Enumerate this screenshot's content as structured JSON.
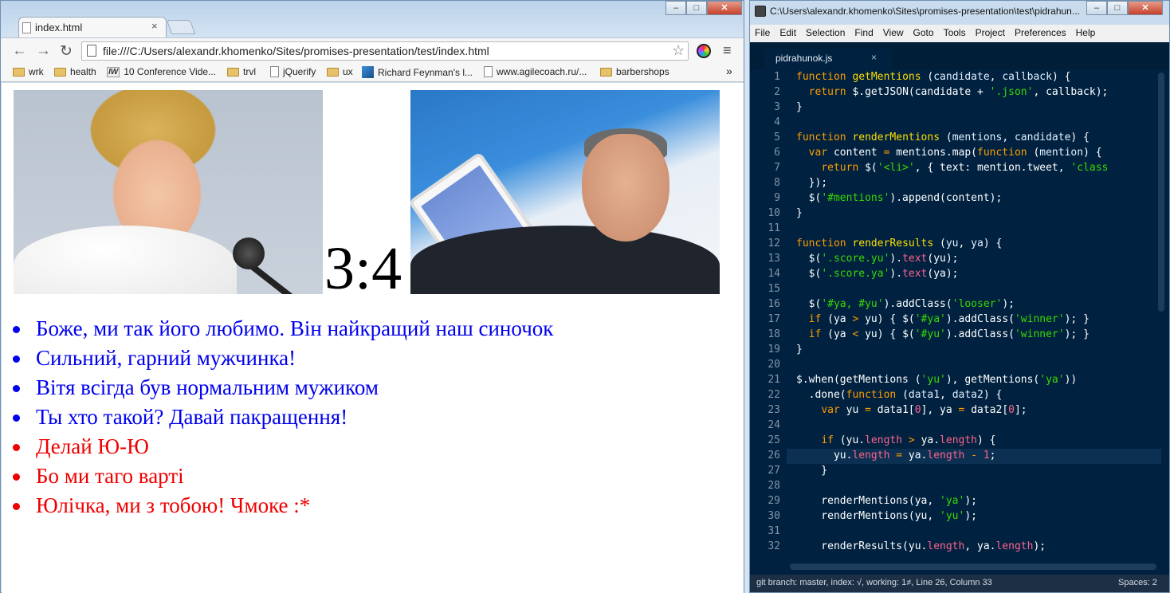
{
  "browser": {
    "tab_title": "index.html",
    "tab_close": "×",
    "url": "file:///C:/Users/alexandr.khomenko/Sites/promises-presentation/test/index.html",
    "back": "←",
    "forward": "→",
    "reload": "↻",
    "star": "☆",
    "menu": "≡",
    "more": "»",
    "bookmarks": [
      "wrk",
      "health",
      "10 Conference Vide...",
      "trvl",
      "jQuerify",
      "ux",
      "Richard Feynman's l...",
      "www.agilecoach.ru/...",
      "barbershops"
    ],
    "window_buttons": [
      "–",
      "□",
      "✕"
    ]
  },
  "page": {
    "score_text": "3:4",
    "score_yu": 3,
    "score_ya": 4,
    "mentions": [
      {
        "text": "Боже, ми так його любимо. Він найкращий наш синочок",
        "class": "winner"
      },
      {
        "text": "Сильний, гарний мужчинка!",
        "class": "winner"
      },
      {
        "text": "Вітя всігда був нормальним мужиком",
        "class": "winner"
      },
      {
        "text": "Ты хто такой? Давай пакращення!",
        "class": "winner"
      },
      {
        "text": "Делай Ю-Ю",
        "class": "looser"
      },
      {
        "text": "Бо ми таго варті",
        "class": "looser"
      },
      {
        "text": "Юлічка, ми з тобою! Чмоке :*",
        "class": "looser"
      }
    ],
    "colors": {
      "winner": "#0000ee",
      "looser": "#ee0000"
    }
  },
  "editor": {
    "title": "C:\\Users\\alexandr.khomenko\\Sites\\promises-presentation\\test\\pidrahun...",
    "menu": [
      "File",
      "Edit",
      "Selection",
      "Find",
      "View",
      "Goto",
      "Tools",
      "Project",
      "Preferences",
      "Help"
    ],
    "tab": "pidrahunok.js",
    "tab_close": "×",
    "line_numbers": [
      "1",
      "2",
      "3",
      "4",
      "5",
      "6",
      "7",
      "8",
      "9",
      "10",
      "11",
      "12",
      "13",
      "14",
      "15",
      "16",
      "17",
      "18",
      "19",
      "20",
      "21",
      "22",
      "23",
      "24",
      "25",
      "26",
      "27",
      "28",
      "29",
      "30",
      "31",
      "32"
    ],
    "code": [
      [
        [
          "kw",
          "function "
        ],
        [
          "fn",
          "getMentions "
        ],
        [
          "pl",
          "("
        ],
        [
          "arg",
          "candidate"
        ],
        [
          "pl",
          ", "
        ],
        [
          "arg",
          "callback"
        ],
        [
          "pl",
          ") {"
        ]
      ],
      [
        [
          "pl",
          "  "
        ],
        [
          "kw",
          "return "
        ],
        [
          "pl",
          "$.getJSON(candidate + "
        ],
        [
          "str",
          "'.json'"
        ],
        [
          "pl",
          ", callback);"
        ]
      ],
      [
        [
          "pl",
          "}"
        ]
      ],
      [],
      [
        [
          "kw",
          "function "
        ],
        [
          "fn",
          "renderMentions "
        ],
        [
          "pl",
          "("
        ],
        [
          "arg",
          "mentions"
        ],
        [
          "pl",
          ", "
        ],
        [
          "arg",
          "candidate"
        ],
        [
          "pl",
          ") {"
        ]
      ],
      [
        [
          "pl",
          "  "
        ],
        [
          "kw",
          "var "
        ],
        [
          "pl",
          "content "
        ],
        [
          "kw",
          "= "
        ],
        [
          "pl",
          "mentions.map("
        ],
        [
          "kw",
          "function "
        ],
        [
          "pl",
          "("
        ],
        [
          "arg",
          "mention"
        ],
        [
          "pl",
          ") {"
        ]
      ],
      [
        [
          "pl",
          "    "
        ],
        [
          "kw",
          "return "
        ],
        [
          "pl",
          "$("
        ],
        [
          "str",
          "'<li>'"
        ],
        [
          "pl",
          ", { text: mention.tweet, "
        ],
        [
          "str",
          "'class"
        ]
      ],
      [
        [
          "pl",
          "  });"
        ]
      ],
      [
        [
          "pl",
          "  $("
        ],
        [
          "str",
          "'#mentions'"
        ],
        [
          "pl",
          ").append(content);"
        ]
      ],
      [
        [
          "pl",
          "}"
        ]
      ],
      [],
      [
        [
          "kw",
          "function "
        ],
        [
          "fn",
          "renderResults "
        ],
        [
          "pl",
          "("
        ],
        [
          "arg",
          "yu"
        ],
        [
          "pl",
          ", "
        ],
        [
          "arg",
          "ya"
        ],
        [
          "pl",
          ") {"
        ]
      ],
      [
        [
          "pl",
          "  $("
        ],
        [
          "str",
          "'.score.yu'"
        ],
        [
          "pl",
          ")."
        ],
        [
          "prop",
          "text"
        ],
        [
          "pl",
          "(yu);"
        ]
      ],
      [
        [
          "pl",
          "  $("
        ],
        [
          "str",
          "'.score.ya'"
        ],
        [
          "pl",
          ")."
        ],
        [
          "prop",
          "text"
        ],
        [
          "pl",
          "(ya);"
        ]
      ],
      [],
      [
        [
          "pl",
          "  $("
        ],
        [
          "str",
          "'#ya, #yu'"
        ],
        [
          "pl",
          ").addClass("
        ],
        [
          "str",
          "'looser'"
        ],
        [
          "pl",
          ");"
        ]
      ],
      [
        [
          "pl",
          "  "
        ],
        [
          "kw",
          "if "
        ],
        [
          "pl",
          "(ya "
        ],
        [
          "kw",
          "> "
        ],
        [
          "pl",
          "yu) { $("
        ],
        [
          "str",
          "'#ya'"
        ],
        [
          "pl",
          ").addClass("
        ],
        [
          "str",
          "'winner'"
        ],
        [
          "pl",
          "); }"
        ]
      ],
      [
        [
          "pl",
          "  "
        ],
        [
          "kw",
          "if "
        ],
        [
          "pl",
          "(ya "
        ],
        [
          "kw",
          "< "
        ],
        [
          "pl",
          "yu) { $("
        ],
        [
          "str",
          "'#yu'"
        ],
        [
          "pl",
          ").addClass("
        ],
        [
          "str",
          "'winner'"
        ],
        [
          "pl",
          "); }"
        ]
      ],
      [
        [
          "pl",
          "}"
        ]
      ],
      [],
      [
        [
          "pl",
          "$.when(getMentions ("
        ],
        [
          "str",
          "'yu'"
        ],
        [
          "pl",
          "), getMentions("
        ],
        [
          "str",
          "'ya'"
        ],
        [
          "pl",
          "))"
        ]
      ],
      [
        [
          "pl",
          "  .done("
        ],
        [
          "kw",
          "function "
        ],
        [
          "pl",
          "("
        ],
        [
          "arg",
          "data1"
        ],
        [
          "pl",
          ", "
        ],
        [
          "arg",
          "data2"
        ],
        [
          "pl",
          ") {"
        ]
      ],
      [
        [
          "pl",
          "    "
        ],
        [
          "kw",
          "var "
        ],
        [
          "pl",
          "yu "
        ],
        [
          "kw",
          "= "
        ],
        [
          "pl",
          "data1["
        ],
        [
          "num",
          "0"
        ],
        [
          "pl",
          "], ya "
        ],
        [
          "kw",
          "= "
        ],
        [
          "pl",
          "data2["
        ],
        [
          "num",
          "0"
        ],
        [
          "pl",
          "];"
        ]
      ],
      [],
      [
        [
          "pl",
          "    "
        ],
        [
          "kw",
          "if "
        ],
        [
          "pl",
          "(yu."
        ],
        [
          "prop",
          "length "
        ],
        [
          "kw",
          "> "
        ],
        [
          "pl",
          "ya."
        ],
        [
          "prop",
          "length"
        ],
        [
          "pl",
          ") {"
        ]
      ],
      [
        [
          "pl",
          "      yu."
        ],
        [
          "prop",
          "length "
        ],
        [
          "kw",
          "= "
        ],
        [
          "pl",
          "ya."
        ],
        [
          "prop",
          "length "
        ],
        [
          "kw",
          "- "
        ],
        [
          "num",
          "1"
        ],
        [
          "pl",
          ";"
        ]
      ],
      [
        [
          "pl",
          "    }"
        ]
      ],
      [],
      [
        [
          "pl",
          "    renderMentions(ya, "
        ],
        [
          "str",
          "'ya'"
        ],
        [
          "pl",
          ");"
        ]
      ],
      [
        [
          "pl",
          "    renderMentions(yu, "
        ],
        [
          "str",
          "'yu'"
        ],
        [
          "pl",
          ");"
        ]
      ],
      [],
      [
        [
          "pl",
          "    renderResults(yu."
        ],
        [
          "prop",
          "length"
        ],
        [
          "pl",
          ", ya."
        ],
        [
          "prop",
          "length"
        ],
        [
          "pl",
          ");"
        ]
      ]
    ],
    "status_left": "git branch: master, index: √, working: 1≠, Line 26, Column 33",
    "status_right": "Spaces: 2"
  }
}
